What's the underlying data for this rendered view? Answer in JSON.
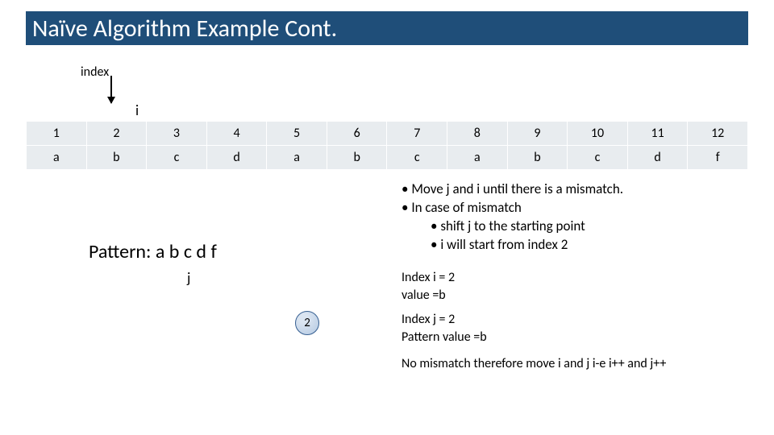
{
  "title": "Naïve Algorithm Example Cont.",
  "index_label": "index",
  "i_label": "i",
  "table": {
    "row1": {
      "c1": "1",
      "c2": "2",
      "c3": "3",
      "c4": "4",
      "c5": "5",
      "c6": "6",
      "c7": "7",
      "c8": "8",
      "c9": "9",
      "c10": "10",
      "c11": "11",
      "c12": "12"
    },
    "row2": {
      "c1": "a",
      "c2": "b",
      "c3": "c",
      "c4": "d",
      "c5": "a",
      "c6": "b",
      "c7": "c",
      "c8": "a",
      "c9": "b",
      "c10": "c",
      "c11": "d",
      "c12": "f"
    }
  },
  "pattern_label": "Pattern: a b c d f",
  "j_label": "j",
  "circle_value": "2",
  "bullets": {
    "b1": "Move j and i until there is a mismatch.",
    "b2": "In case of mismatch",
    "b3": "shift j to the starting point",
    "b4": "i will start from index 2"
  },
  "status": {
    "i_line1": "Index i = 2",
    "i_line2": "value =b",
    "j_line1": "Index j = 2",
    "j_line2": "Pattern value =b",
    "final": "No mismatch therefore move i and j i-e i++ and j++"
  }
}
